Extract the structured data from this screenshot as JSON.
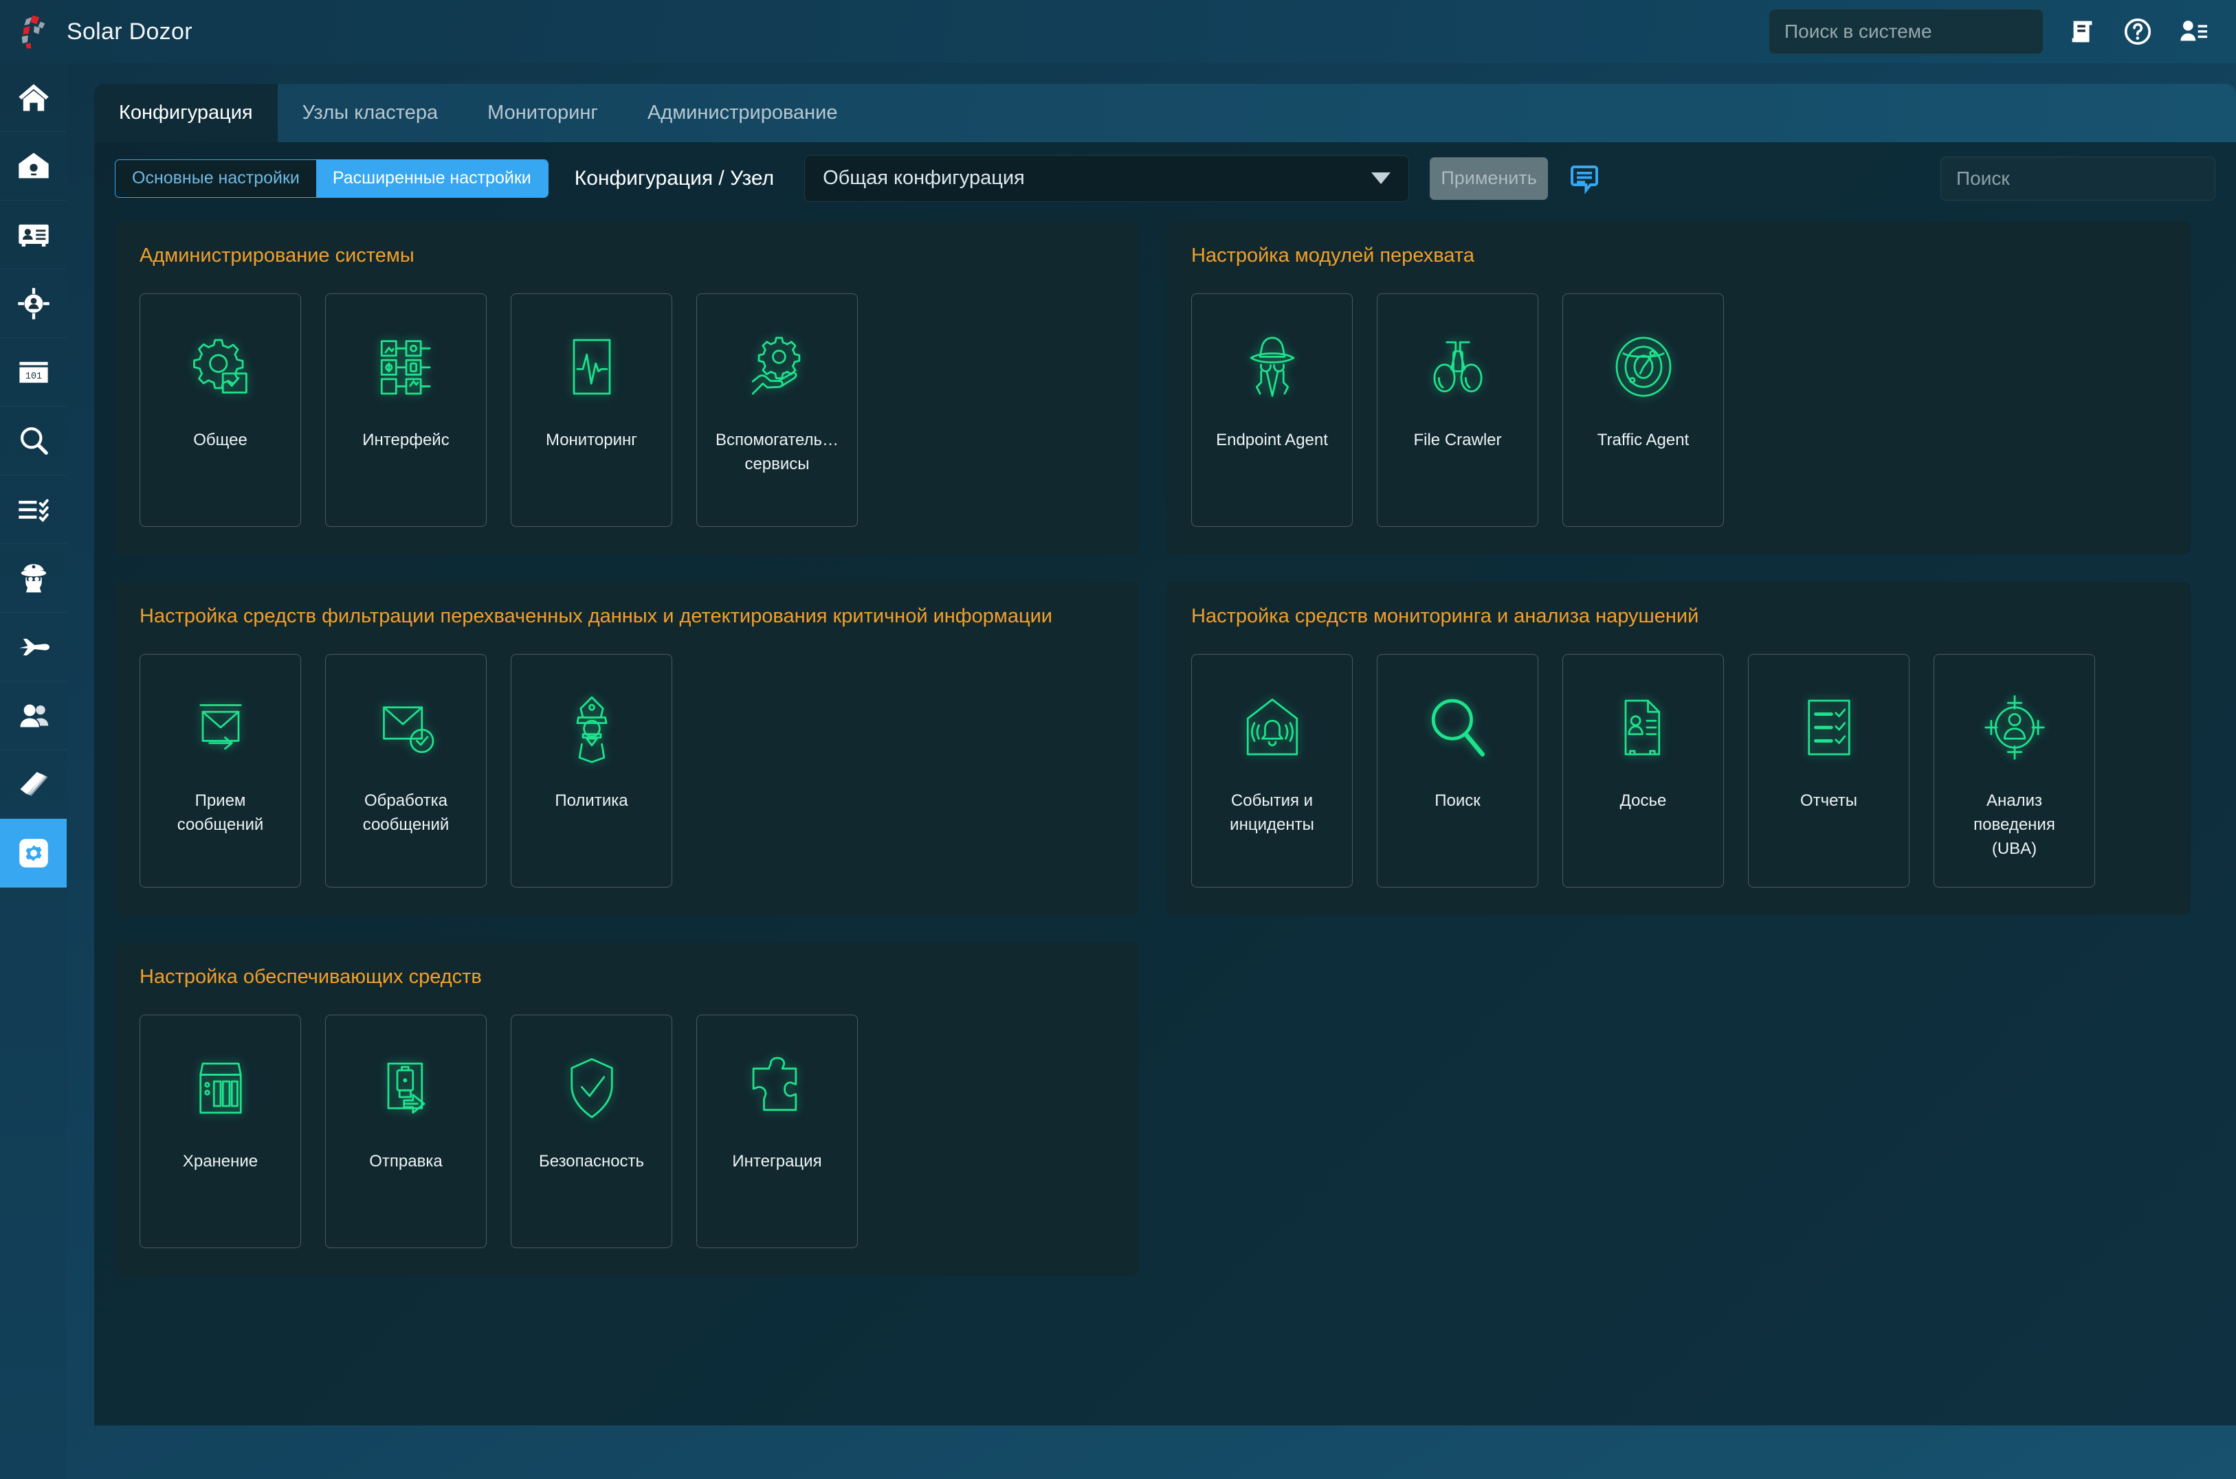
{
  "app": {
    "title": "Solar Dozor",
    "logo_icon": "solar-dozor-logo"
  },
  "topbar": {
    "search": {
      "placeholder": "Поиск в системе",
      "value": "",
      "icon": "search-icon"
    },
    "actions": [
      {
        "name": "journal-icon",
        "label": "Журнал"
      },
      {
        "name": "help-icon",
        "label": "Помощь"
      },
      {
        "name": "user-menu-icon",
        "label": "Пользователь"
      }
    ]
  },
  "sidebar": {
    "items": [
      {
        "icon": "home-icon",
        "label": "Главная",
        "active": false
      },
      {
        "icon": "events-incidents-icon",
        "label": "События и инциденты",
        "active": false
      },
      {
        "icon": "dossier-icon",
        "label": "Досье",
        "active": false
      },
      {
        "icon": "uba-target-icon",
        "label": "Анализ поведения",
        "active": false
      },
      {
        "icon": "binary-data-icon",
        "label": "Данные",
        "active": false
      },
      {
        "icon": "search-icon",
        "label": "Поиск",
        "active": false
      },
      {
        "icon": "reports-icon",
        "label": "Отчеты",
        "active": false
      },
      {
        "icon": "police-policy-icon",
        "label": "Политика",
        "active": false
      },
      {
        "icon": "jet-icon",
        "label": "Перехват",
        "active": false
      },
      {
        "icon": "people-icon",
        "label": "Сотрудники",
        "active": false
      },
      {
        "icon": "book-icon",
        "label": "Справочник",
        "active": false
      },
      {
        "icon": "gear-icon",
        "label": "Конфигурация",
        "active": true
      }
    ]
  },
  "tabs": [
    {
      "label": "Конфигурация",
      "active": true
    },
    {
      "label": "Узлы кластера",
      "active": false
    },
    {
      "label": "Мониторинг",
      "active": false
    },
    {
      "label": "Администрирование",
      "active": false
    }
  ],
  "toolbar": {
    "segmented": [
      {
        "label": "Основные настройки",
        "selected": false
      },
      {
        "label": "Расширенные настройки",
        "selected": true
      }
    ],
    "breadcrumb": "Конфигурация / Узел",
    "config_select": {
      "value": "Общая конфигурация",
      "icon": "chevron-down-icon"
    },
    "apply_label": "Применить",
    "apply_disabled": true,
    "note_icon": "comment-icon",
    "search": {
      "placeholder": "Поиск",
      "value": "",
      "icon": "search-icon"
    }
  },
  "colors": {
    "accent_blue": "#36a7f0",
    "panel_title": "#f2a02a",
    "icon_green": "#1fe28d",
    "panel_bg": "#11282f",
    "content_bg": "#0d2c38"
  },
  "sections": [
    {
      "title": "Администрирование системы",
      "column": "left",
      "cards": [
        {
          "label": "Общее",
          "icon": "gear-checklist-icon"
        },
        {
          "label": "Интерфейс",
          "icon": "interface-grid-icon"
        },
        {
          "label": "Мониторинг",
          "icon": "pulse-monitor-icon"
        },
        {
          "label": "Вспомогатель…\nсервисы",
          "icon": "gear-hand-services-icon"
        }
      ]
    },
    {
      "title": "Настройка модулей перехвата",
      "column": "right",
      "cards": [
        {
          "label": "Endpoint Agent",
          "icon": "spy-agent-icon"
        },
        {
          "label": "File Crawler",
          "icon": "binoculars-icon"
        },
        {
          "label": "Traffic Agent",
          "icon": "radar-target-icon"
        }
      ]
    },
    {
      "title": "Настройка средств фильтрации перехваченных данных и детектирования критичной информации",
      "column": "left",
      "cards": [
        {
          "label": "Прием\nсообщений",
          "icon": "mail-receive-icon"
        },
        {
          "label": "Обработка\nсообщений",
          "icon": "mail-check-icon"
        },
        {
          "label": "Политика",
          "icon": "police-policy-icon"
        }
      ]
    },
    {
      "title": "Настройка средств мониторинга и анализа нарушений",
      "column": "right",
      "cards": [
        {
          "label": "События и\nинциденты",
          "icon": "events-incidents-icon"
        },
        {
          "label": "Поиск",
          "icon": "magnifier-icon"
        },
        {
          "label": "Досье",
          "icon": "dossier-icon"
        },
        {
          "label": "Отчеты",
          "icon": "reports-checklist-icon"
        },
        {
          "label": "Анализ\nповедения\n(UBA)",
          "icon": "uba-target-icon"
        }
      ]
    },
    {
      "title": "Настройка обеспечивающих средств",
      "column": "left",
      "cards": [
        {
          "label": "Хранение",
          "icon": "storage-icon"
        },
        {
          "label": "Отправка",
          "icon": "dispatch-icon"
        },
        {
          "label": "Безопасность",
          "icon": "shield-check-icon"
        },
        {
          "label": "Интеграция",
          "icon": "puzzle-icon"
        }
      ]
    }
  ]
}
